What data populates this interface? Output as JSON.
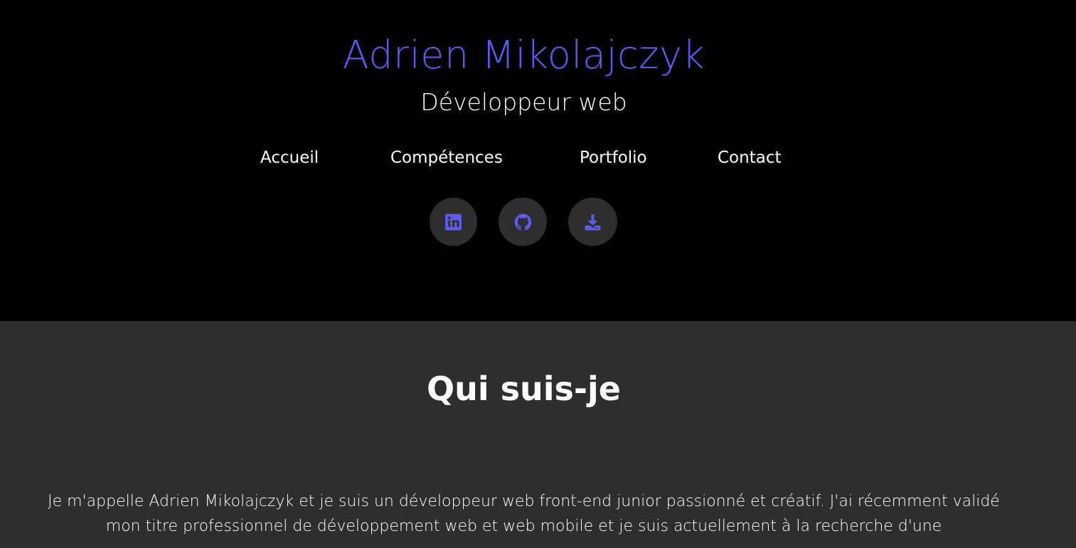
{
  "header": {
    "name": "Adrien Mikolajczyk",
    "role": "Développeur web",
    "name_color": "#5b5bf0"
  },
  "nav": {
    "items": [
      {
        "label": "Accueil"
      },
      {
        "label": "Compétences"
      },
      {
        "label": "Portfolio"
      },
      {
        "label": "Contact"
      }
    ]
  },
  "socials": [
    {
      "icon": "linkedin-icon"
    },
    {
      "icon": "github-icon"
    },
    {
      "icon": "download-icon"
    }
  ],
  "about": {
    "title": "Qui suis-je",
    "text": "Je m'appelle Adrien Mikolajczyk et je suis un développeur web front-end junior passionné et créatif. J'ai récemment validé mon titre professionnel de développement web et web mobile et je suis actuellement à la recherche d'une"
  },
  "colors": {
    "accent": "#5b5bf0",
    "header_bg": "#000000",
    "section_bg": "#2e2e2e",
    "icon_button_bg": "#2e2e2e"
  }
}
